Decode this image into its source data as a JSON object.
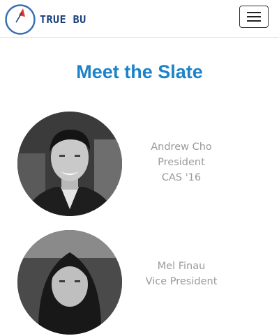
{
  "brand": {
    "name": "TRUE BU",
    "logo_icon": "compass-icon",
    "logo_ring_color": "#3a6fb5",
    "logo_needle_color": "#e53a2a"
  },
  "navbar": {
    "menu_icon": "hamburger-menu-icon"
  },
  "page": {
    "title": "Meet the Slate",
    "title_color": "#1b83c9"
  },
  "members": [
    {
      "name": "Andrew Cho",
      "role": "President",
      "school": "CAS '16"
    },
    {
      "name": "Mel Finau",
      "role": "Vice President"
    }
  ]
}
